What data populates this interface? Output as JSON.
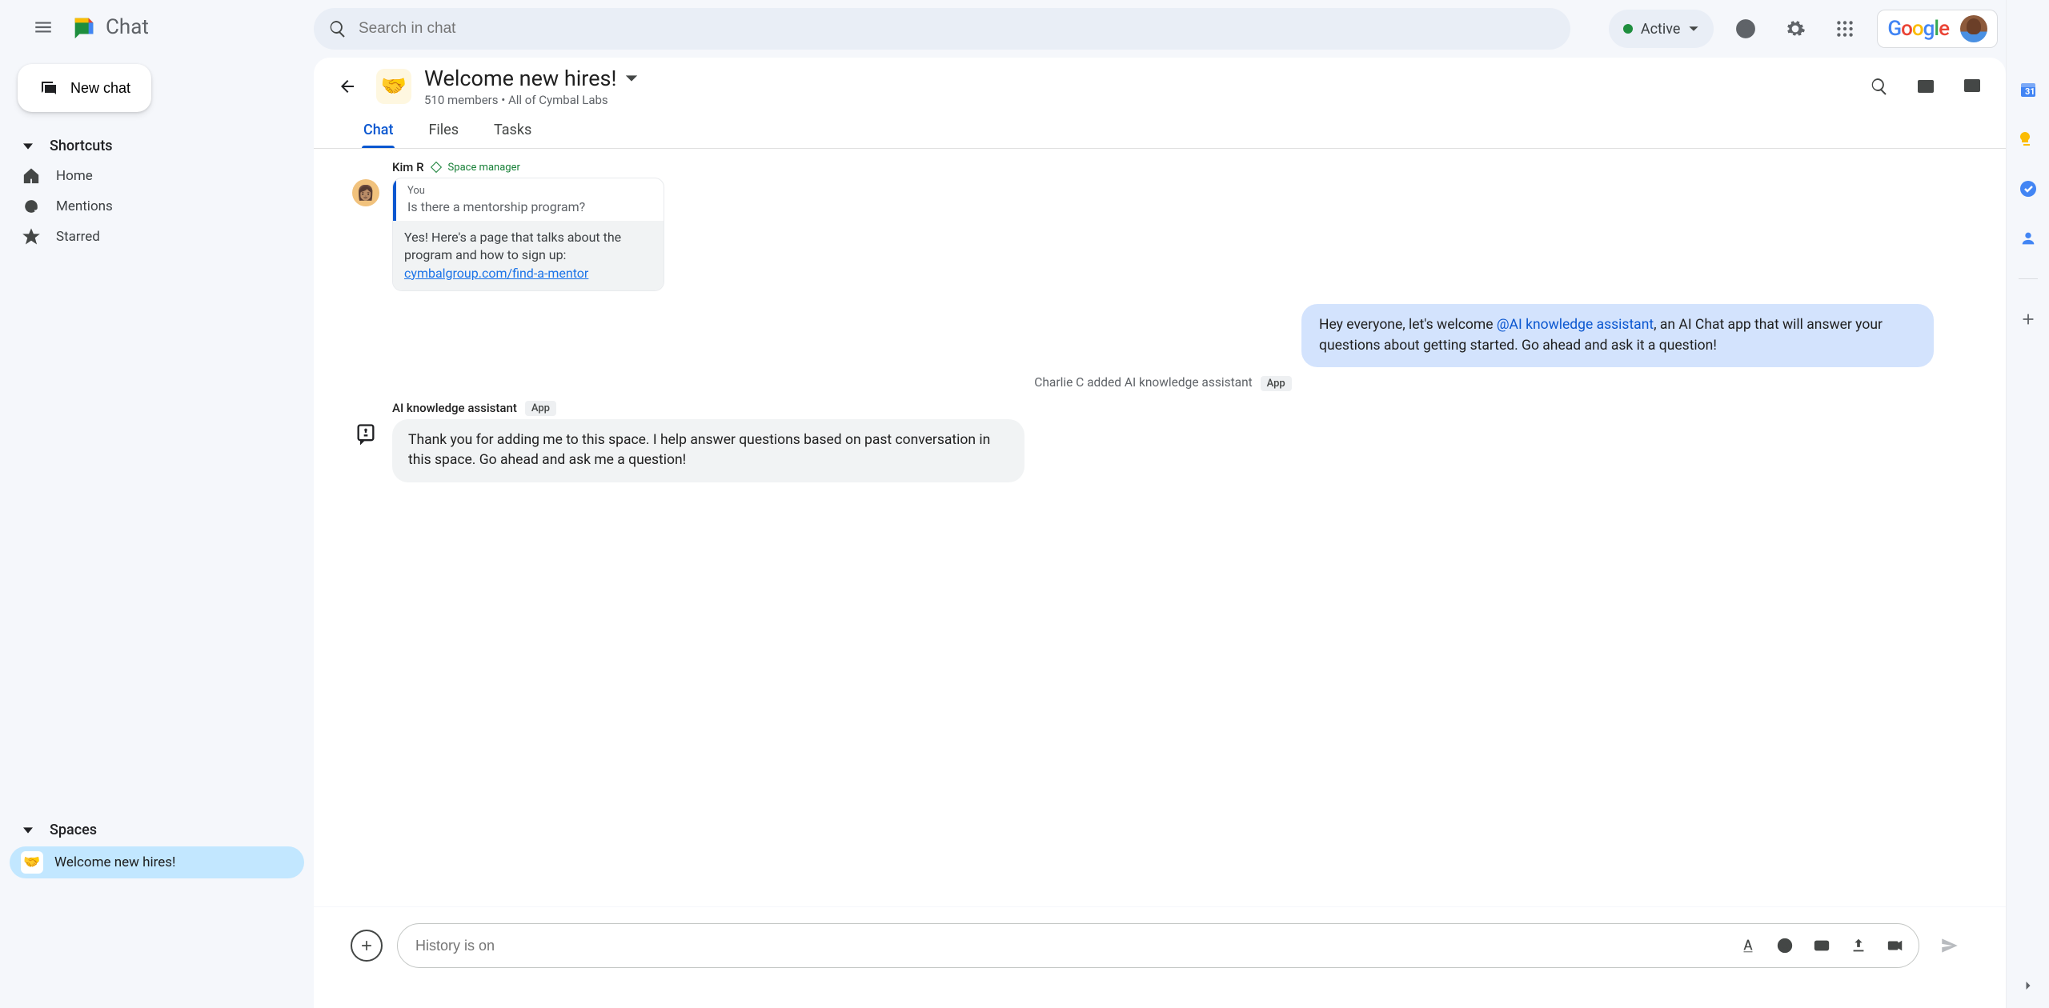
{
  "app": {
    "title": "Chat",
    "new_chat_label": "New chat"
  },
  "sidebar": {
    "shortcuts_header": "Shortcuts",
    "items": [
      {
        "label": "Home"
      },
      {
        "label": "Mentions"
      },
      {
        "label": "Starred"
      }
    ],
    "spaces_header": "Spaces",
    "spaces": [
      {
        "emoji": "🤝",
        "label": "Welcome new hires!"
      }
    ]
  },
  "search": {
    "placeholder": "Search in chat"
  },
  "status": {
    "label": "Active"
  },
  "space_header": {
    "emoji": "🤝",
    "title": "Welcome new hires!",
    "subtitle": "510 members  •  All of Cymbal Labs"
  },
  "tabs": [
    {
      "label": "Chat"
    },
    {
      "label": "Files"
    },
    {
      "label": "Tasks"
    }
  ],
  "messages": {
    "kim": {
      "author": "Kim R",
      "badge": "Space manager",
      "quote_you": "You",
      "quote_text": "Is there a mentorship program?",
      "reply_text": "Yes! Here's a page that talks about the program and how to sign up: ",
      "reply_link": "cymbalgroup.com/find-a-mentor"
    },
    "mine": {
      "prefix": "Hey everyone, let's welcome ",
      "mention": "@AI knowledge assistant",
      "suffix": ", an AI Chat app that will answer your questions about getting started.  Go ahead and ask it a question!"
    },
    "system": {
      "text": "Charlie C added AI knowledge assistant",
      "badge": "App"
    },
    "bot": {
      "author": "AI knowledge assistant",
      "badge": "App",
      "text": "Thank you for adding me to this space. I help answer questions based on past conversation in this space. Go ahead and ask me a question!"
    }
  },
  "compose": {
    "placeholder": "History is on"
  },
  "google_logo": "Google"
}
